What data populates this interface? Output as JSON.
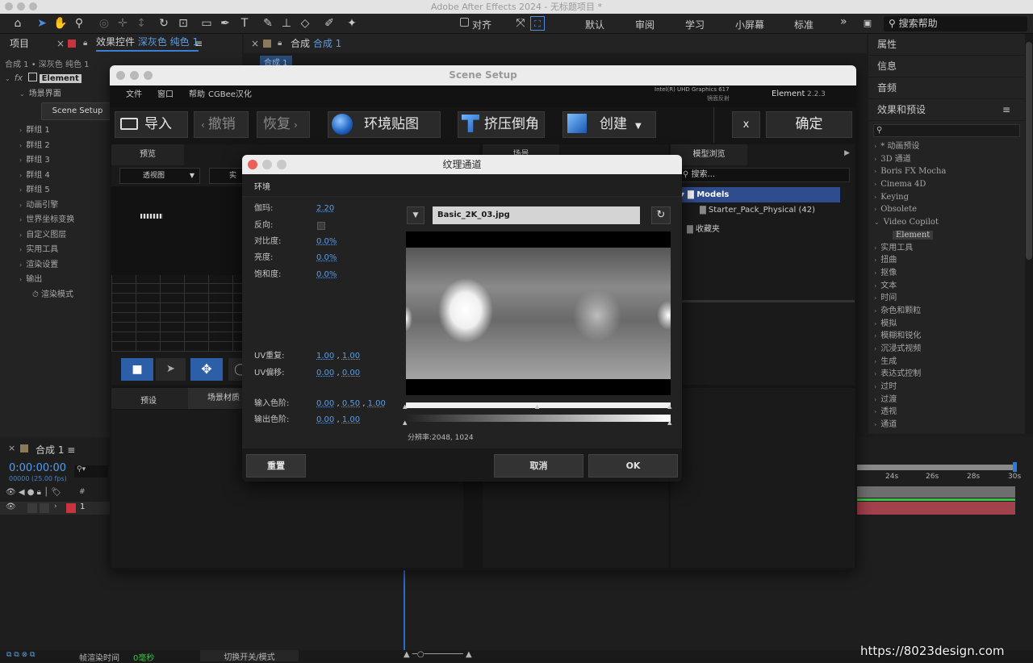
{
  "os_title": "Adobe After Effects 2024 - 无标题项目 *",
  "toolbar": {
    "align_label": "对齐",
    "workspaces": [
      "默认",
      "审阅",
      "学习",
      "小屏幕",
      "标准"
    ],
    "more": "»",
    "search_help": "搜索帮助"
  },
  "left_panel": {
    "tab_project": "项目",
    "tab_effects": "效果控件",
    "tab_effects_layer": "深灰色 纯色 1",
    "breadcrumb": "合成 1 • 深灰色 纯色 1",
    "fx_label": "fx",
    "effect_name": "Element",
    "scene_interface": "场景界面",
    "scene_setup_btn": "Scene Setup",
    "groups": [
      "群组 1",
      "群组 2",
      "群组 3",
      "群组 4",
      "群组 5",
      "动画引擎",
      "世界坐标变换",
      "自定义图层",
      "实用工具",
      "渲染设置",
      "输出"
    ],
    "render_mode": "渲染模式"
  },
  "comp_panel": {
    "tab_label": "合成",
    "tab_name": "合成 1",
    "subtab": "合成 1"
  },
  "plugin": {
    "title": "Scene Setup",
    "menu": [
      "文件",
      "窗口",
      "帮助",
      "CGBee汉化"
    ],
    "gpu": "Intel(R) UHD Graphics 617",
    "mirror": "镜面反射",
    "product": "Element",
    "version": "2.2.3",
    "buttons": {
      "import": "导入",
      "undo": "撤销",
      "redo": "恢复",
      "env_map": "环境贴图",
      "extrude": "挤压倒角",
      "create": "创建",
      "close": "x",
      "ok": "确定"
    },
    "preview": {
      "header": "预览",
      "view_select": "透视图",
      "view_select2": "实时"
    },
    "scene": {
      "header": "场景"
    },
    "model_browser": {
      "header": "模型浏览",
      "search": "搜索...",
      "models": "Models",
      "starter": "Starter_Pack_Physical (42)",
      "favorites": "收藏夹"
    },
    "presets_tab": "预设",
    "scene_material_tab": "场景材质"
  },
  "dialog": {
    "title": "纹理通道",
    "section": "环境",
    "gamma_label": "伽玛:",
    "gamma": "2.20",
    "invert_label": "反向:",
    "contrast_label": "对比度:",
    "contrast": "0.0%",
    "brightness_label": "亮度:",
    "brightness": "0.0%",
    "saturation_label": "饱和度:",
    "saturation": "0.0%",
    "uv_repeat_label": "UV重复:",
    "uv_repeat_u": "1.00",
    "uv_repeat_v": "1.00",
    "uv_offset_label": "UV偏移:",
    "uv_offset_u": "0.00",
    "uv_offset_v": "0.00",
    "input_levels_label": "输入色阶:",
    "in_black": "0.00",
    "in_gamma": "0.50",
    "in_white": "1.00",
    "output_levels_label": "输出色阶:",
    "out_black": "0.00",
    "out_white": "1.00",
    "file_name": "Basic_2K_03.jpg",
    "resolution": "分辨率:2048, 1024",
    "reset": "重置",
    "cancel": "取消",
    "ok": "OK"
  },
  "right_panel": {
    "properties": "属性",
    "info": "信息",
    "audio": "音频",
    "effects_presets": "效果和预设",
    "categories": [
      "* 动画预设",
      "3D 通道",
      "Boris FX Mocha",
      "Cinema 4D",
      "Keying",
      "Obsolete",
      "Video Copilot",
      "Element",
      "实用工具",
      "扭曲",
      "抠像",
      "文本",
      "时间",
      "杂色和颗粒",
      "模拟",
      "模糊和锐化",
      "沉浸式视频",
      "生成",
      "表达式控制",
      "过时",
      "过渡",
      "透视",
      "通道"
    ]
  },
  "timeline": {
    "tab": "合成 1",
    "timecode": "0:00:00:00",
    "fps": "00000 (25.00 fps)",
    "layer_num": "1",
    "hash": "#",
    "ticks": [
      "24s",
      "26s",
      "28s",
      "30s"
    ]
  },
  "status": {
    "render_time_label": "帧渲染时间",
    "render_time": "0毫秒",
    "toggle": "切换开关/模式"
  },
  "watermark": "https://8023design.com"
}
